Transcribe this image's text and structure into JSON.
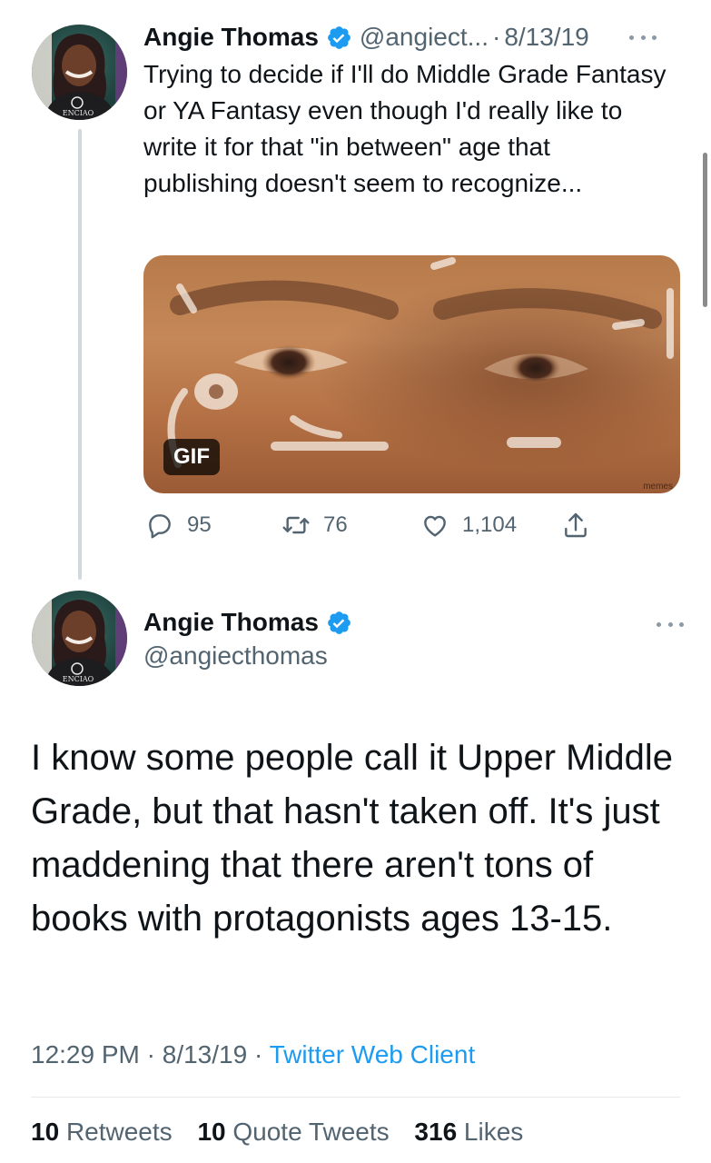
{
  "tweet1": {
    "name": "Angie Thomas",
    "handle": "@angiect...",
    "separator": "·",
    "date": "8/13/19",
    "text": "Trying to decide if I'll do Middle Grade Fantasy or YA Fantasy even though I'd really like to write it for that \"in between\" age that publishing doesn't seem to recognize...",
    "media": {
      "badge": "GIF",
      "watermark": "memes"
    },
    "actions": {
      "replies": "95",
      "retweets": "76",
      "likes": "1,104"
    }
  },
  "tweet2": {
    "name": "Angie Thomas",
    "handle": "@angiecthomas",
    "text": "I know some people call it Upper Middle Grade, but that hasn't taken off. It's just maddening that there aren't tons of books with protagonists ages 13-15.",
    "time": "12:29 PM",
    "separator": "·",
    "date": "8/13/19",
    "client": "Twitter Web Client",
    "stats": {
      "retweets_count": "10",
      "retweets_label": "Retweets",
      "quotes_count": "10",
      "quotes_label": "Quote Tweets",
      "likes_count": "316",
      "likes_label": "Likes"
    }
  },
  "avatar_shirt_text": "ENCIAO",
  "colors": {
    "verified": "#1d9bf0",
    "link": "#1d9bf0",
    "secondary_text": "#536471"
  }
}
